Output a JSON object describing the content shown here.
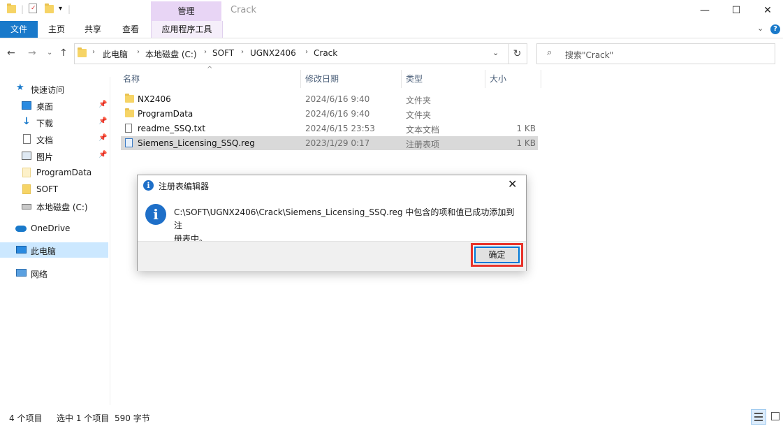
{
  "titlebar": {
    "manage_tab": "管理",
    "window_title": "Crack",
    "minimize": "—",
    "maximize": "☐",
    "close": "✕"
  },
  "ribbon": {
    "tabs": [
      "文件",
      "主页",
      "共享",
      "查看",
      "应用程序工具"
    ]
  },
  "address": {
    "crumbs": [
      "此电脑",
      "本地磁盘 (C:)",
      "SOFT",
      "UGNX2406",
      "Crack"
    ],
    "search_placeholder": "搜索\"Crack\""
  },
  "navpane": {
    "items": [
      {
        "label": "快速访问"
      },
      {
        "label": "桌面"
      },
      {
        "label": "下载"
      },
      {
        "label": "文档"
      },
      {
        "label": "图片"
      },
      {
        "label": "ProgramData"
      },
      {
        "label": "SOFT"
      },
      {
        "label": "本地磁盘 (C:)"
      },
      {
        "label": "OneDrive"
      },
      {
        "label": "此电脑"
      },
      {
        "label": "网络"
      }
    ]
  },
  "filelist": {
    "columns": [
      "名称",
      "修改日期",
      "类型",
      "大小"
    ],
    "rows": [
      {
        "name": "NX2406",
        "date": "2024/6/16 9:40",
        "type": "文件夹",
        "size": ""
      },
      {
        "name": "ProgramData",
        "date": "2024/6/16 9:40",
        "type": "文件夹",
        "size": ""
      },
      {
        "name": "readme_SSQ.txt",
        "date": "2024/6/15 23:53",
        "type": "文本文档",
        "size": "1 KB"
      },
      {
        "name": "Siemens_Licensing_SSQ.reg",
        "date": "2023/1/29 0:17",
        "type": "注册表项",
        "size": "1 KB"
      }
    ]
  },
  "dialog": {
    "title": "注册表编辑器",
    "message_line1": "C:\\SOFT\\UGNX2406\\Crack\\Siemens_Licensing_SSQ.reg 中包含的项和值已成功添加到注",
    "message_line2": "册表中。",
    "ok_label": "确定",
    "info_glyph": "i",
    "close_glyph": "✕"
  },
  "statusbar": {
    "item_count": "4 个项目",
    "selected": "选中 1 个项目",
    "size": "590 字节"
  }
}
